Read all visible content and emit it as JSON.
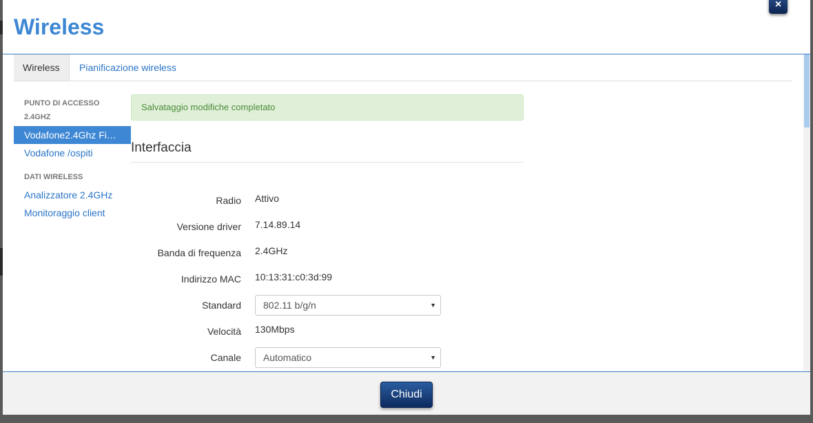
{
  "modal": {
    "title": "Wireless",
    "close_label": "×",
    "footer_button": "Chiudi"
  },
  "tabs": [
    {
      "label": "Wireless",
      "active": true
    },
    {
      "label": "Pianificazione wireless",
      "active": false
    }
  ],
  "sidebar": {
    "group1_heading_line1": "PUNTO DI ACCESSO",
    "group1_heading_line2": "2.4GHZ",
    "group1_items": [
      {
        "label": "Vodafone2.4Ghz Fi…",
        "selected": true
      },
      {
        "label": "Vodafone /ospiti",
        "selected": false
      }
    ],
    "group2_heading": "DATI WIRELESS",
    "group2_items": [
      {
        "label": "Analizzatore 2.4GHz"
      },
      {
        "label": "Monitoraggio client"
      }
    ]
  },
  "alert": {
    "text": "Salvataggio modifiche completato"
  },
  "section": {
    "title": "Interfaccia"
  },
  "fields": [
    {
      "label": "Radio",
      "value": "Attivo"
    },
    {
      "label": "Versione driver",
      "value": "7.14.89.14"
    },
    {
      "label": "Banda di frequenza",
      "value": "2.4GHz"
    },
    {
      "label": "Indirizzo MAC",
      "value": "10:13:31:c0:3d:99"
    },
    {
      "label": "Standard",
      "value": "802.11 b/g/n",
      "type": "select"
    },
    {
      "label": "Velocità",
      "value": "130Mbps"
    },
    {
      "label": "Canale",
      "value": "Automatico",
      "type": "select"
    }
  ],
  "colors": {
    "accent": "#3d87d4",
    "link": "#2a74c6",
    "alert_bg": "#e0f0d8",
    "alert_text": "#4a8a3a",
    "button": "#0d2a5e"
  },
  "icons": {
    "close": "close-icon",
    "dropdown": "chevron-down-icon"
  }
}
